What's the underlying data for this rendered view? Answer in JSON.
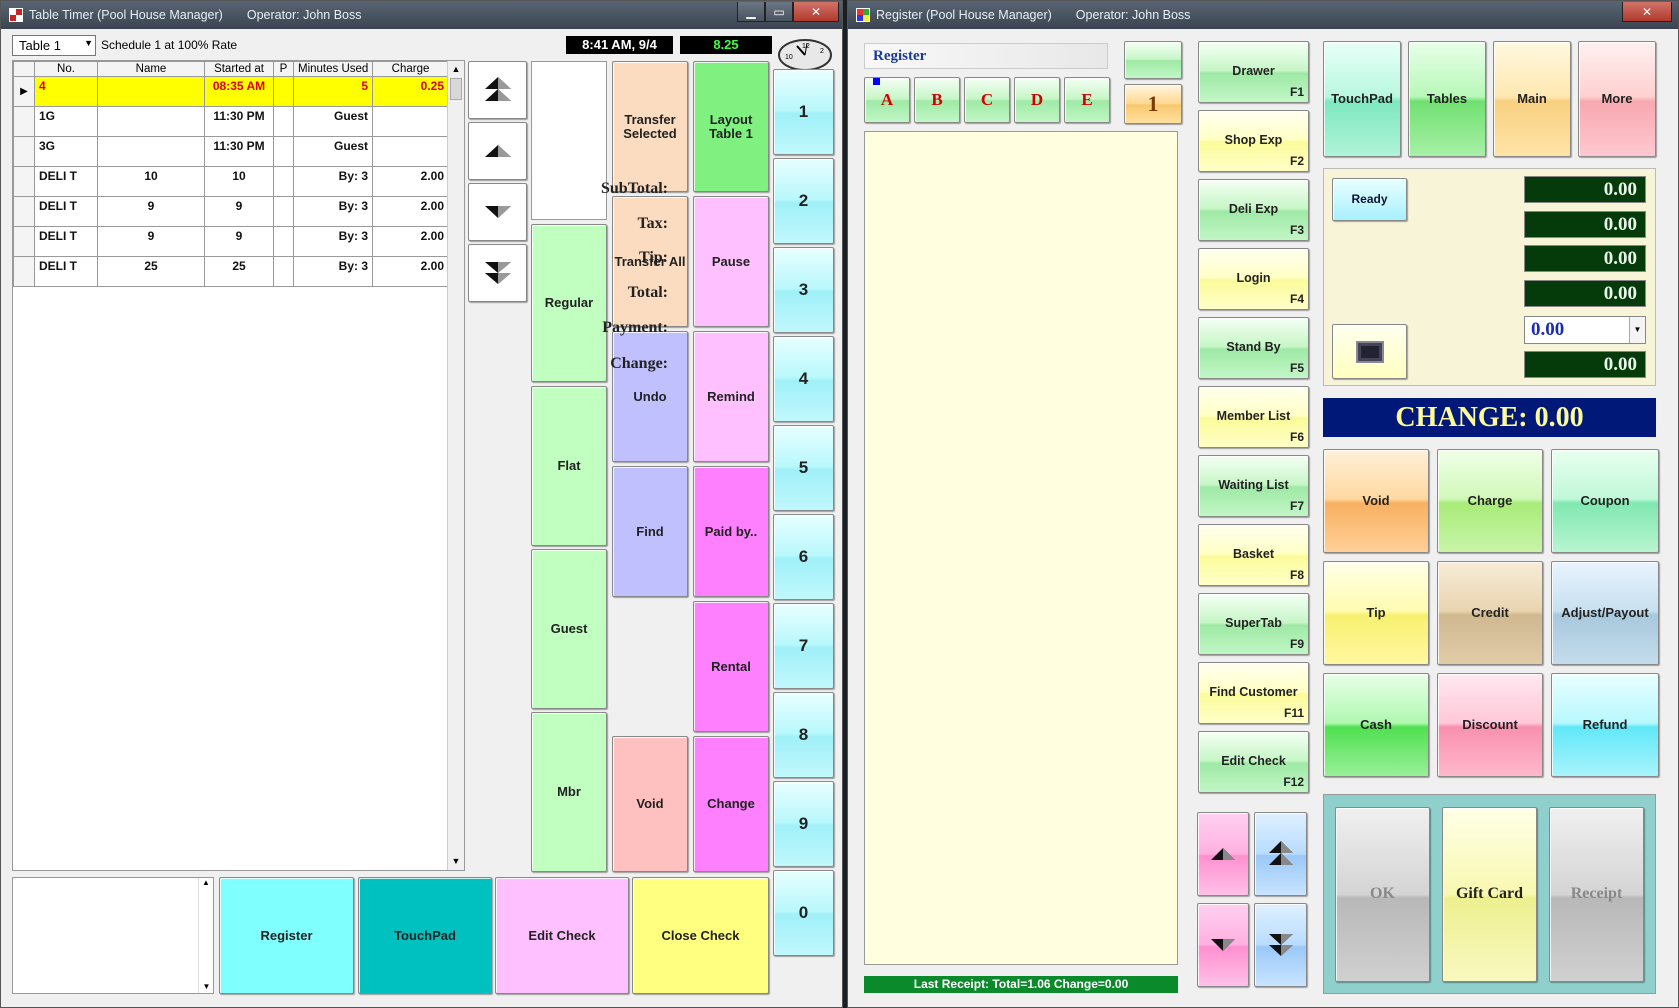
{
  "left_window": {
    "title": "Table Timer (Pool House Manager)",
    "operator": "Operator: John Boss",
    "table_select": "Table 1",
    "schedule": "Schedule 1 at 100% Rate",
    "clock": "8:41 AM, 9/4",
    "amount": "8.25",
    "columns": [
      "No.",
      "Name",
      "Started at",
      "P",
      "Minutes Used",
      "Charge"
    ],
    "rows": [
      [
        "4",
        "",
        "08:35 AM",
        "",
        "5",
        "0.25"
      ],
      [
        "1G",
        "",
        "11:30 PM",
        "",
        "Guest",
        ""
      ],
      [
        "3G",
        "",
        "11:30 PM",
        "",
        "Guest",
        ""
      ],
      [
        "DELI T",
        "10",
        "10",
        "",
        "By:   3",
        "2.00"
      ],
      [
        "DELI T",
        "9",
        "9",
        "",
        "By:   3",
        "2.00"
      ],
      [
        "DELI T",
        "9",
        "9",
        "",
        "By:   3",
        "2.00"
      ],
      [
        "DELI T",
        "25",
        "25",
        "",
        "By:   3",
        "2.00"
      ]
    ],
    "rate_buttons": [
      "Regular",
      "Flat",
      "Guest",
      "Mbr"
    ],
    "col3_buttons": [
      "Transfer Selected",
      "Transfer All",
      "Undo",
      "Find",
      "Void"
    ],
    "col4_buttons": [
      "Layout Table 1",
      "Pause",
      "Remind",
      "Paid by..",
      "Rental",
      "Change"
    ],
    "number_buttons": [
      "1",
      "2",
      "3",
      "4",
      "5",
      "6",
      "7",
      "8",
      "9",
      "0"
    ],
    "bottom_buttons": [
      "Register",
      "TouchPad",
      "Edit Check",
      "Close Check"
    ],
    "clock_face": {
      "n12": "12",
      "n10": "10",
      "n2": "2"
    }
  },
  "right_window": {
    "title": "Register (Pool House Manager)",
    "operator": "Operator: John Boss",
    "register_label": "Register",
    "letters": [
      "A",
      "B",
      "C",
      "D",
      "E"
    ],
    "seat": "1",
    "function_keys": [
      {
        "label": "Drawer",
        "key": "F1"
      },
      {
        "label": "Shop Exp",
        "key": "F2"
      },
      {
        "label": "Deli Exp",
        "key": "F3"
      },
      {
        "label": "Login",
        "key": "F4"
      },
      {
        "label": "Stand By",
        "key": "F5"
      },
      {
        "label": "Member List",
        "key": "F6"
      },
      {
        "label": "Waiting List",
        "key": "F7"
      },
      {
        "label": "Basket",
        "key": "F8"
      },
      {
        "label": "SuperTab",
        "key": "F9"
      },
      {
        "label": "Find Customer",
        "key": "F11"
      },
      {
        "label": "Edit Check",
        "key": "F12"
      }
    ],
    "top_nav": [
      "TouchPad",
      "Tables",
      "Main",
      "More"
    ],
    "status": "Ready",
    "totals": {
      "subtotal_label": "SubTotal:",
      "subtotal": "0.00",
      "tax_label": "Tax:",
      "tax": "0.00",
      "tip_label": "Tip:",
      "tip": "0.00",
      "total_label": "Total:",
      "total": "0.00",
      "payment_label": "Payment:",
      "payment": "0.00",
      "change_label": "Change:",
      "change": "0.00"
    },
    "change_banner": "CHANGE: 0.00",
    "action_buttons": [
      "Void",
      "Charge",
      "Coupon",
      "Tip",
      "Credit",
      "Adjust/Payout",
      "Cash",
      "Discount",
      "Refund"
    ],
    "bottom_buttons": [
      "OK",
      "Gift Card",
      "Receipt"
    ],
    "last_receipt": "Last Receipt: Total=1.06  Change=0.00"
  },
  "colors": {
    "yellow_row": "#ffff00",
    "red_text": "#e00000",
    "cyan": "#80ffff",
    "teal": "#00c0c0",
    "pink": "#ffc0ff",
    "magenta": "#ff80ff",
    "peach": "#fcdcc0",
    "lavender": "#c0c0ff",
    "green": "#80f080",
    "banner_navy": "#001878",
    "banner_text": "#fffb9a"
  }
}
